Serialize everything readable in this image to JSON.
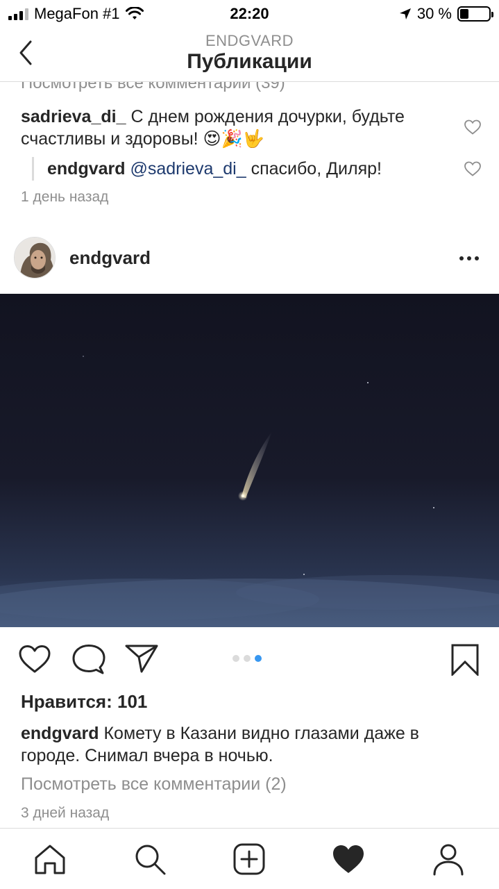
{
  "status_bar": {
    "carrier": "MegaFon #1",
    "time": "22:20",
    "battery": "30 %",
    "battery_level": 0.3
  },
  "header": {
    "username": "ENDGVARD",
    "title": "Публикации"
  },
  "previous_post": {
    "view_all_comments": "Посмотреть все комментарии (39)",
    "comment": {
      "user": "sadrieva_di_",
      "text": "С днем рождения дочурки, будьте счастливы и здоровы! 😍🎉🤟"
    },
    "reply": {
      "user": "endgvard",
      "mention": "@sadrieva_di_",
      "text": "спасибо, Диляр!"
    },
    "time": "1 день назад"
  },
  "post": {
    "username": "endgvard",
    "carousel": {
      "count": 3,
      "active_index": 2
    },
    "likes": "Нравится: 101",
    "caption_user": "endgvard",
    "caption_text": "Комету в Казани видно глазами даже в городе. Снимал вчера в ночью.",
    "view_all_comments": "Посмотреть все комментарии (2)",
    "time": "3 дней назад"
  },
  "icons": {
    "back": "chevron-left-icon",
    "more": "more-horizontal-icon",
    "like": "heart-outline-icon",
    "comment": "comment-bubble-icon",
    "share": "paper-plane-icon",
    "save": "bookmark-icon"
  },
  "tabbar": {
    "items": [
      "home-icon",
      "search-icon",
      "new-post-icon",
      "activity-heart-icon",
      "profile-icon"
    ],
    "active": "activity-heart-icon"
  },
  "colors": {
    "link": "#1e3a6e",
    "carousel_active": "#3897f0",
    "secondary_text": "#8e8e8e"
  }
}
